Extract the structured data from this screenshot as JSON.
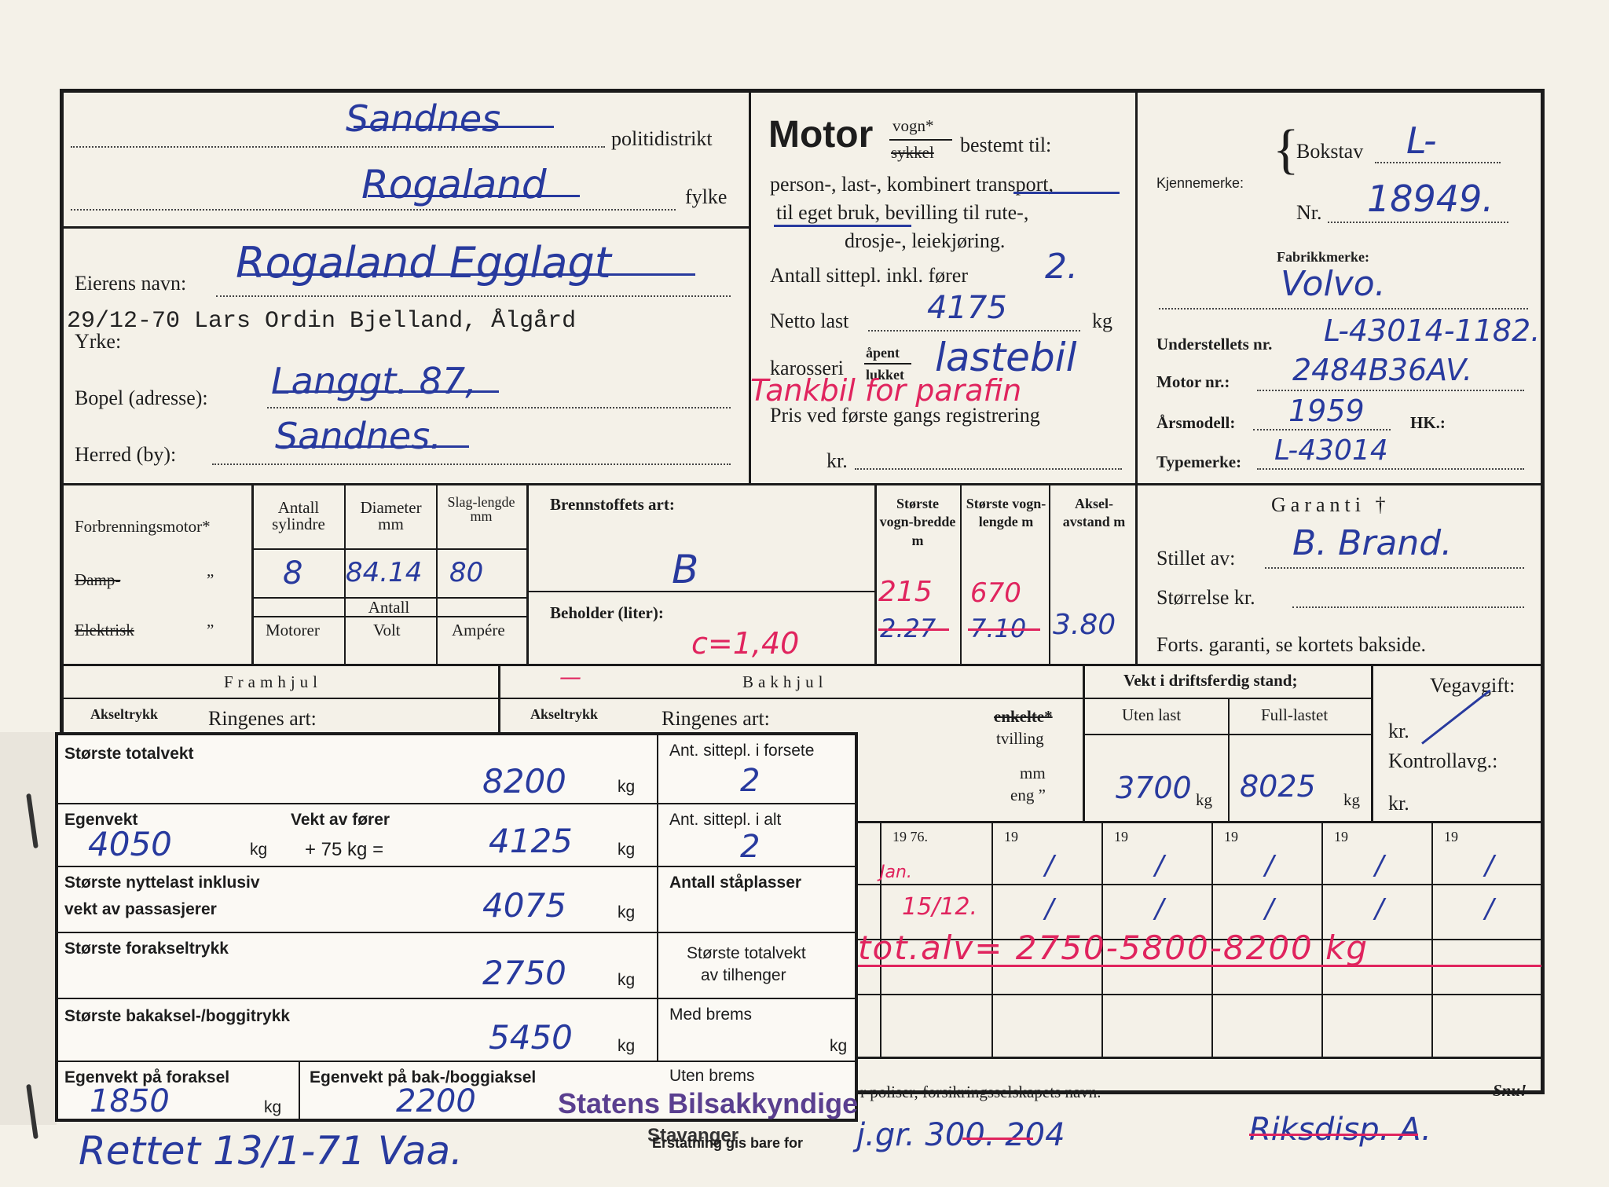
{
  "header": {
    "district_value": "Sandnes",
    "district_label": "politidistrikt",
    "county_value": "Rogaland",
    "county_label": "fylke",
    "owner_label": "Eierens navn:",
    "owner_value": "Rogaland Egglagt",
    "typed_owner": "29/12-70 Lars Ordin Bjelland, Ålgård",
    "occupation_label": "Yrke:",
    "address_label": "Bopel (adresse):",
    "address_value": "Langgt. 87,",
    "municipality_label": "Herred (by):",
    "municipality_value": "Sandnes."
  },
  "motor": {
    "title": "Motor",
    "vogn": "vogn*",
    "sykkel": "sykkel",
    "intended": "bestemt til:",
    "line1": "person-, last-, kombinert transport,",
    "line2": "til eget bruk, bevilling til rute-,",
    "line3": "drosje-, leiekjøring.",
    "seats_label": "Antall sittepl. inkl. fører",
    "seats_value": "2.",
    "netto_label": "Netto last",
    "netto_value": "4175",
    "netto_unit": "kg",
    "body_label": "karosseri",
    "body_open": "åpent",
    "body_closed": "lukket",
    "body_value": "lastebil",
    "red_note": "Tankbil for parafin",
    "price_label": "Pris ved første gangs registrering",
    "price_currency": "kr."
  },
  "registration": {
    "plate_label": "Kjennemerke:",
    "letter_label": "Bokstav",
    "letter_value": "L-",
    "number_label": "Nr.",
    "number_value": "18949.",
    "make_label": "Fabrikkmerke:",
    "make_value": "Volvo.",
    "chassis_label": "Understellets nr.",
    "chassis_value": "L-43014-1182.",
    "engine_label": "Motor nr.:",
    "engine_value": "2484B36AV.",
    "year_label": "Årsmodell:",
    "year_value": "1959",
    "hp_label": "HK.:",
    "type_label": "Typemerke:",
    "type_value": "L-43014"
  },
  "engine": {
    "combustion_label": "Forbrenningsmotor*",
    "steam_label": "Damp-",
    "electric_label": "Elektrisk",
    "ditto": "”",
    "cyl_header": "Antall sylindre",
    "dia_header": "Diameter mm",
    "stroke_header": "Slag-lengde mm",
    "cyl_value": "8",
    "dia_value": "84.14",
    "stroke_value": "80",
    "antall": "Antall",
    "motors": "Motorer",
    "volt": "Volt",
    "ampere": "Ampére",
    "fuel_label": "Brennstoffets art:",
    "fuel_value": "B",
    "tank_label": "Beholder (liter):",
    "tank_value": "c=1,40",
    "width_header": "Største vogn-bredde m",
    "length_header": "Største vogn-lengde m",
    "axle_header": "Aksel-avstand m",
    "width_value": "215",
    "width_old": "2.27",
    "length_value": "670",
    "length_old": "7.10",
    "axle_value": "3.80"
  },
  "guarantee": {
    "title": "Garanti †",
    "issued_label": "Stillet av:",
    "issued_value": "B. Brand.",
    "size_label": "Størrelse kr.",
    "continued": "Forts. garanti, se kortets bakside."
  },
  "wheels": {
    "front": "Framhjul",
    "rear": "Bakhjul",
    "axle_load": "Akseltrykk",
    "tyre_kind": "Ringenes art:",
    "single": "enkelte*",
    "double": "tvilling",
    "mm": "mm",
    "eng": "eng ”",
    "weight_title": "Vekt i driftsferdig stand;",
    "without_load": "Uten last",
    "full_load": "Full-lastet",
    "without_value": "3700",
    "full_value": "8025",
    "unit": "kg",
    "road_tax": "Vegavgift:",
    "kr": "kr.",
    "control": "Kontrollavg.:",
    "kr2": "kr."
  },
  "years": [
    "19 76.",
    "19",
    "19",
    "19",
    "19",
    "19"
  ],
  "red_line": "tot.alv= 2750-5800-8200 kg",
  "red_dates": [
    "Jan.",
    "15/12."
  ],
  "bottom": {
    "insurance": "r poliser, forsikringsselskapets navn.",
    "snu": "Snu!",
    "rettet": "Rettet 13/1-71 Vaa.",
    "reg_nr": "j.gr. 300. 204",
    "riksdisp": "Riksdisp. A."
  },
  "overlay": {
    "max_total_label": "Største totalvekt",
    "max_total_value": "8200",
    "own_weight_label": "Egenvekt",
    "own_weight_value": "4050",
    "driver_label": "Vekt av fører",
    "driver_formula": "+ 75 kg =",
    "driver_value": "4125",
    "payload_label": "Største nyttelast inklusiv",
    "payload_label2": "vekt av passasjerer",
    "payload_value": "4075",
    "front_axle_label": "Største forakseltrykk",
    "front_axle_value": "2750",
    "rear_axle_label": "Største bakaksel-/boggitrykk",
    "rear_axle_value": "5450",
    "own_front_label": "Egenvekt på foraksel",
    "own_front_value": "1850",
    "own_rear_label": "Egenvekt på bak-/boggiaksel",
    "own_rear_value": "2200",
    "kg": "kg",
    "seats_front_label": "Ant. sittepl. i forsete",
    "seats_front_value": "2",
    "seats_total_label": "Ant. sittepl. i alt",
    "seats_total_value": "2",
    "standing_label": "Antall ståplasser",
    "trailer_label": "Største totalvekt",
    "trailer_label2": "av tilhenger",
    "brake_label": "Med brems",
    "nobrake_label": "Uten brems",
    "stamp1": "Statens Bilsakkyndige",
    "stamp2": "Stavanger",
    "stamp_small": "Erstatning gis bare for"
  },
  "colors": {
    "ink_blue": "#283a9e",
    "ink_red": "#e0245e",
    "stamp": "#5a3f8f"
  }
}
